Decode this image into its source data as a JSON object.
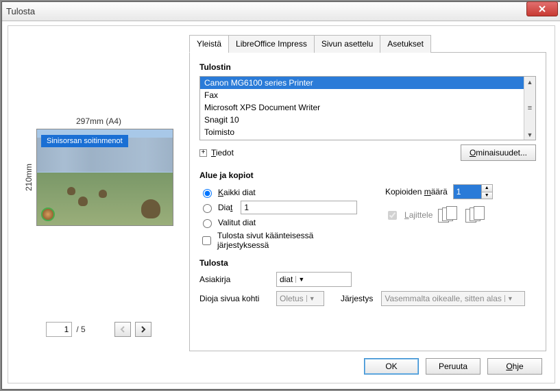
{
  "window": {
    "title": "Tulosta"
  },
  "tabs": {
    "general": "Yleistä",
    "impress": "LibreOffice Impress",
    "layout": "Sivun asettelu",
    "options": "Asetukset"
  },
  "preview": {
    "widthLabel": "297mm (A4)",
    "heightLabel": "210mm",
    "slideTitle": "Sinisorsan soitinmenot",
    "page": "1",
    "total": "/ 5"
  },
  "printer": {
    "section": "Tulostin",
    "items": [
      "Canon MG6100 series Printer",
      "Fax",
      "Microsoft XPS Document Writer",
      "Snagit 10",
      "Toimisto"
    ],
    "details": "Tiedot",
    "propertiesBtn": "Ominaisuudet..."
  },
  "range": {
    "section": "Alue ja kopiot",
    "allSlides": "Kaikki diat",
    "slides": "Diat",
    "slidesValue": "1",
    "selected": "Valitut diat",
    "reverse": "Tulosta sivut käänteisessä järjestyksessä",
    "copiesLabel": "Kopioiden määrä",
    "copiesValue": "1",
    "collate": "Lajittele"
  },
  "print": {
    "section": "Tulosta",
    "docLabel": "Asiakirja",
    "docValue": "diat",
    "perPageLabel": "Dioja sivua kohti",
    "perPageValue": "Oletus",
    "orderLabel": "Järjestys",
    "orderValue": "Vasemmalta oikealle, sitten alas"
  },
  "buttons": {
    "ok": "OK",
    "cancel": "Peruuta",
    "help": "Ohje"
  },
  "accel": {
    "details_u": "T",
    "properties_u": "O",
    "allSlides_u": "K",
    "slides_u": "t",
    "copies_u": "m",
    "collate_u": "L",
    "help_u": "O"
  }
}
